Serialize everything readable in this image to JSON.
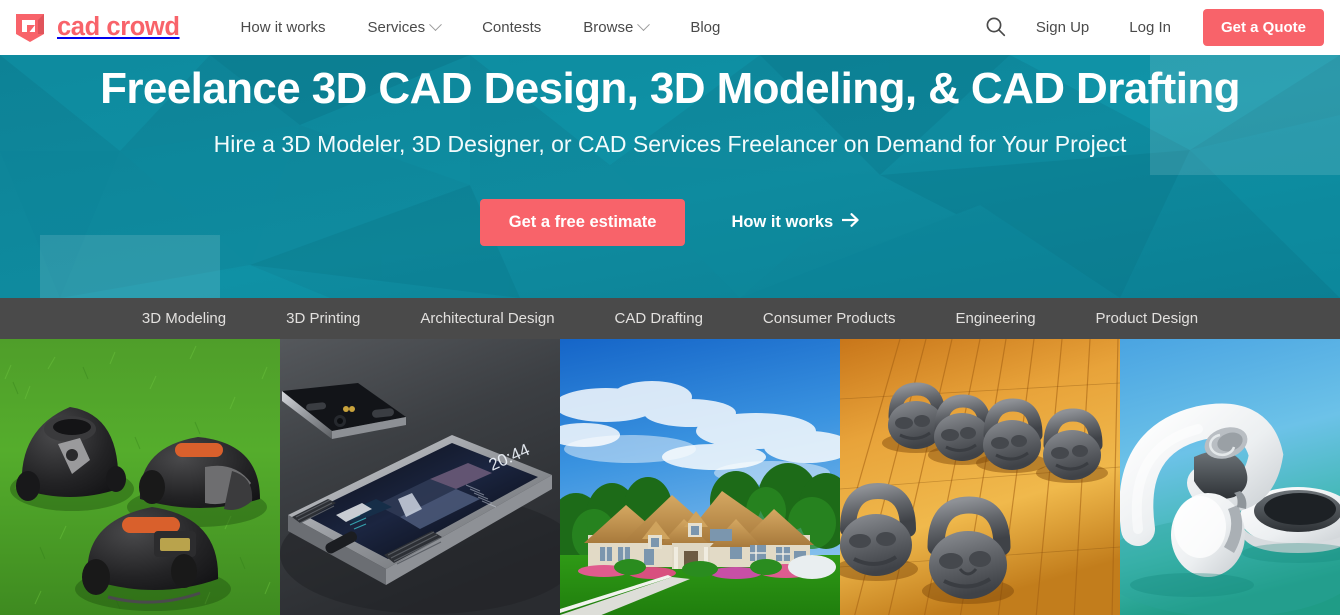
{
  "brand": {
    "name": "cad crowd",
    "logo_icon": "cadcrowd-flag-icon",
    "accent_color": "#f8636a"
  },
  "topnav": {
    "items": [
      {
        "label": "How it works",
        "has_dropdown": false
      },
      {
        "label": "Services",
        "has_dropdown": true
      },
      {
        "label": "Contests",
        "has_dropdown": false
      },
      {
        "label": "Browse",
        "has_dropdown": true
      },
      {
        "label": "Blog",
        "has_dropdown": false
      }
    ],
    "search_icon": "search-icon",
    "sign_up_label": "Sign Up",
    "log_in_label": "Log In",
    "quote_label": "Get a Quote"
  },
  "hero": {
    "title": "Freelance 3D CAD Design, 3D Modeling, & CAD Drafting",
    "subtitle": "Hire a 3D Modeler, 3D Designer, or CAD Services Freelancer on Demand for Your Project",
    "primary_cta": "Get a free estimate",
    "secondary_cta": "How it works",
    "secondary_cta_icon": "arrow-right-icon",
    "background_color": "#0f8a9e",
    "background_style": "low-poly faceted teal"
  },
  "category_bar": {
    "background_color": "#4a4a4a",
    "items": [
      {
        "label": "3D Modeling"
      },
      {
        "label": "3D Printing"
      },
      {
        "label": "Architectural Design"
      },
      {
        "label": "CAD Drafting"
      },
      {
        "label": "Consumer Products"
      },
      {
        "label": "Engineering"
      },
      {
        "label": "Product Design"
      }
    ]
  },
  "gallery": {
    "tiles": [
      {
        "name": "robotic-lawn-mowers",
        "alt": "Three black robotic lawn mowers with orange accents on green grass"
      },
      {
        "name": "smartphone-concept",
        "alt": "Dark metal smartphone concept render, screen reads 20:44",
        "screen_time": "20:44"
      },
      {
        "name": "house-rendering",
        "alt": "Architectural rendering of a suburban house with tan roof, blue sky and green lawn"
      },
      {
        "name": "skull-kettlebells",
        "alt": "Six grey skull-faced kettlebells on an orange wooden gym floor"
      },
      {
        "name": "wearable-concept",
        "alt": "White curved wearable headphone concept on a blue gradient background"
      }
    ]
  }
}
